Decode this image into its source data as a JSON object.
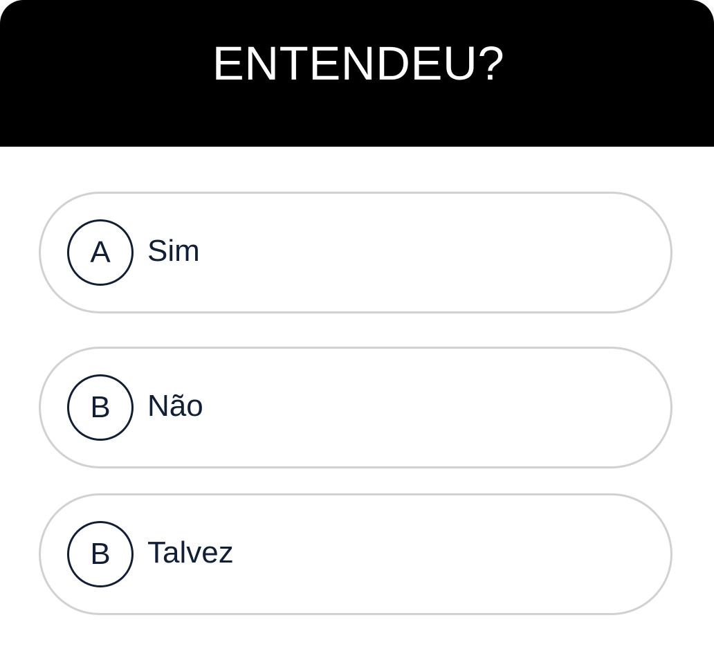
{
  "quiz": {
    "title": "ENTENDEU?",
    "options": [
      {
        "letter": "A",
        "label": "Sim"
      },
      {
        "letter": "B",
        "label": "Não"
      },
      {
        "letter": "B",
        "label": "Talvez"
      }
    ]
  },
  "colors": {
    "header_background": "#000000",
    "title_text": "#ffffff",
    "option_text": "#0f1f38",
    "option_border": "#d4d0d0"
  }
}
